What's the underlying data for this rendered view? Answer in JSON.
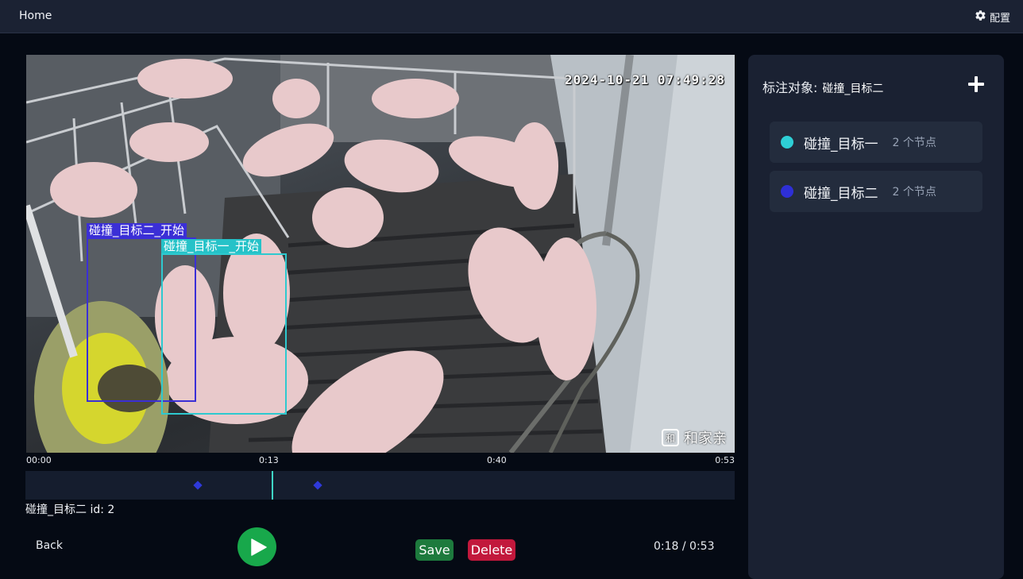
{
  "topbar": {
    "home_label": "Home",
    "config_label": "配置",
    "config_icon": "gear-icon"
  },
  "video": {
    "timestamp": "2024-10-21 07:49:28",
    "watermark": "和家亲",
    "watermark_logo": "和",
    "boxes": [
      {
        "label": "碰撞_目标二_开始",
        "color": "#3b2fd6"
      },
      {
        "label": "碰撞_目标一_开始",
        "color": "#2ec9cf"
      }
    ]
  },
  "timeline": {
    "labels": [
      "00:00",
      "0:13",
      "0:40",
      "0:53"
    ],
    "playhead_color": "#3fd6c6",
    "keyframe_color": "#2e39d9"
  },
  "selection": {
    "text": "碰撞_目标二 id: 2"
  },
  "controls": {
    "back_label": "Back",
    "save_label": "Save",
    "delete_label": "Delete",
    "time": "0:18 / 0:53"
  },
  "panel": {
    "title": "标注对象:",
    "current": "碰撞_目标二",
    "objects": [
      {
        "name": "碰撞_目标一",
        "nodes": "2 个节点",
        "color": "#2ecfd6"
      },
      {
        "name": "碰撞_目标二",
        "nodes": "2 个节点",
        "color": "#2e2fd6"
      }
    ]
  },
  "colors": {
    "accent_play": "#18a84b",
    "save": "#1d7a3d",
    "delete": "#c2183c"
  }
}
